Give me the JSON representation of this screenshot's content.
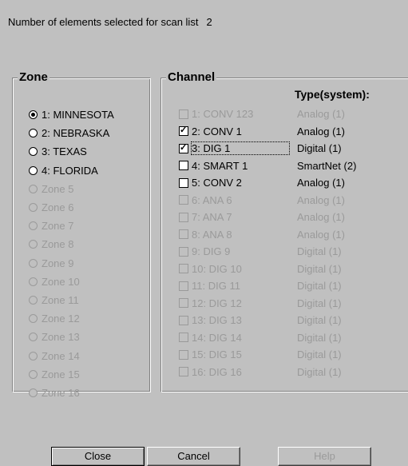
{
  "scan": {
    "label": "Number of elements selected for scan list",
    "count": "2"
  },
  "zone": {
    "title": "Zone",
    "items": [
      {
        "label": "1: MINNESOTA",
        "checked": true,
        "enabled": true
      },
      {
        "label": "2: NEBRASKA",
        "checked": false,
        "enabled": true
      },
      {
        "label": "3: TEXAS",
        "checked": false,
        "enabled": true
      },
      {
        "label": "4: FLORIDA",
        "checked": false,
        "enabled": true
      },
      {
        "label": "Zone 5",
        "checked": false,
        "enabled": false
      },
      {
        "label": "Zone 6",
        "checked": false,
        "enabled": false
      },
      {
        "label": "Zone 7",
        "checked": false,
        "enabled": false
      },
      {
        "label": "Zone 8",
        "checked": false,
        "enabled": false
      },
      {
        "label": "Zone 9",
        "checked": false,
        "enabled": false
      },
      {
        "label": "Zone 10",
        "checked": false,
        "enabled": false
      },
      {
        "label": "Zone 11",
        "checked": false,
        "enabled": false
      },
      {
        "label": "Zone 12",
        "checked": false,
        "enabled": false
      },
      {
        "label": "Zone 13",
        "checked": false,
        "enabled": false
      },
      {
        "label": "Zone 14",
        "checked": false,
        "enabled": false
      },
      {
        "label": "Zone 15",
        "checked": false,
        "enabled": false
      },
      {
        "label": "Zone 16",
        "checked": false,
        "enabled": false
      }
    ]
  },
  "channel": {
    "title": "Channel",
    "type_header": "Type(system):",
    "items": [
      {
        "label": "1: CONV 123",
        "type": "Analog (1)",
        "checked": false,
        "enabled": false
      },
      {
        "label": "2: CONV 1",
        "type": "Analog (1)",
        "checked": true,
        "enabled": true
      },
      {
        "label": "3: DIG 1",
        "type": "Digital (1)",
        "checked": true,
        "enabled": true,
        "focused": true
      },
      {
        "label": "4: SMART 1",
        "type": "SmartNet (2)",
        "checked": false,
        "enabled": true
      },
      {
        "label": "5: CONV 2",
        "type": "Analog (1)",
        "checked": false,
        "enabled": true
      },
      {
        "label": "6: ANA 6",
        "type": "Analog (1)",
        "checked": false,
        "enabled": false
      },
      {
        "label": "7: ANA 7",
        "type": "Analog (1)",
        "checked": false,
        "enabled": false
      },
      {
        "label": "8: ANA 8",
        "type": "Analog (1)",
        "checked": false,
        "enabled": false
      },
      {
        "label": "9: DIG 9",
        "type": "Digital (1)",
        "checked": false,
        "enabled": false
      },
      {
        "label": "10: DIG 10",
        "type": "Digital (1)",
        "checked": false,
        "enabled": false
      },
      {
        "label": "11: DIG 11",
        "type": "Digital (1)",
        "checked": false,
        "enabled": false
      },
      {
        "label": "12: DIG 12",
        "type": "Digital (1)",
        "checked": false,
        "enabled": false
      },
      {
        "label": "13: DIG 13",
        "type": "Digital (1)",
        "checked": false,
        "enabled": false
      },
      {
        "label": "14: DIG 14",
        "type": "Digital (1)",
        "checked": false,
        "enabled": false
      },
      {
        "label": "15: DIG 15",
        "type": "Digital (1)",
        "checked": false,
        "enabled": false
      },
      {
        "label": "16: DIG 16",
        "type": "Digital (1)",
        "checked": false,
        "enabled": false
      }
    ]
  },
  "buttons": {
    "close": "Close",
    "cancel": "Cancel",
    "help": "Help",
    "help_enabled": false
  }
}
